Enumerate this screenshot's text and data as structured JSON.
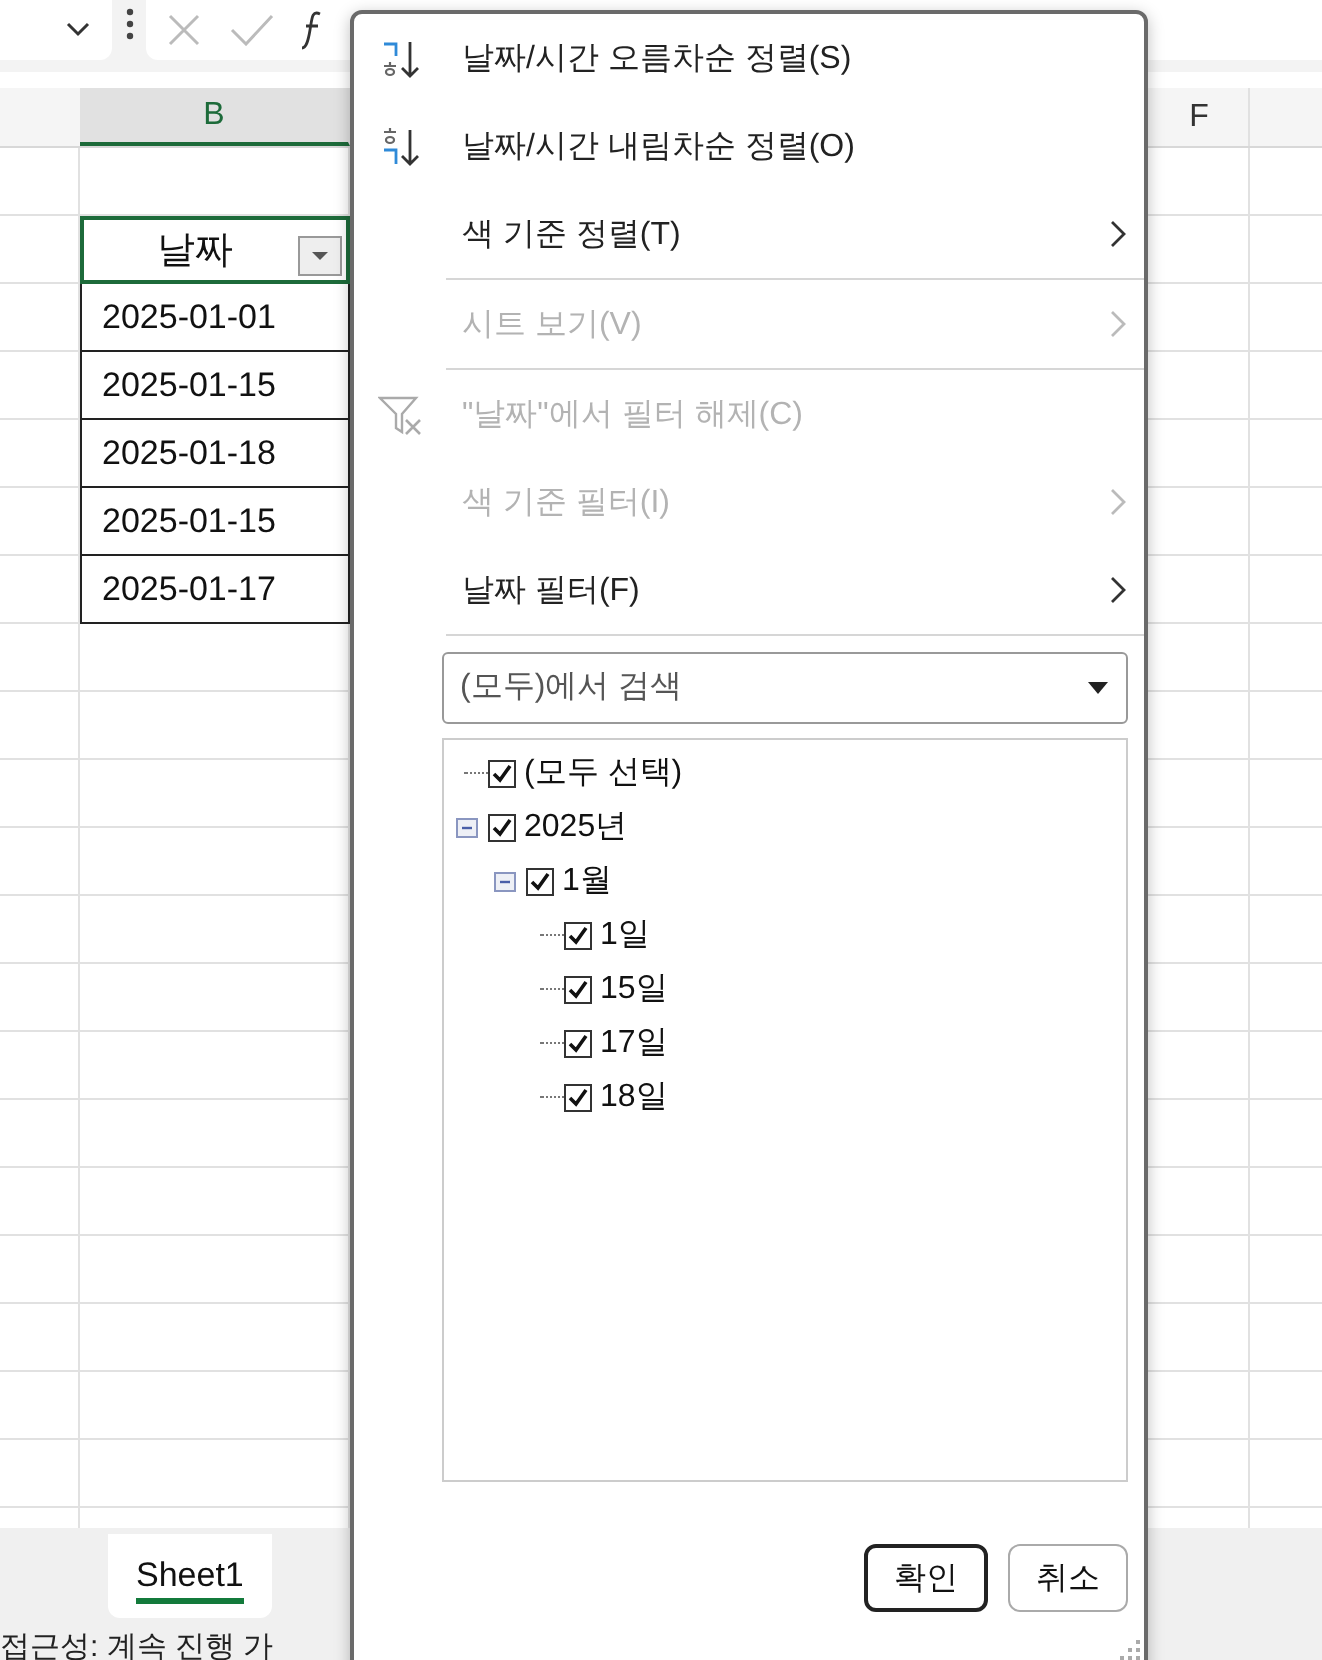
{
  "columns": [
    {
      "label": "B",
      "selected": true
    },
    {
      "label": "F",
      "selected": false
    }
  ],
  "table": {
    "header": "날짜",
    "rows": [
      "2025-01-01",
      "2025-01-15",
      "2025-01-18",
      "2025-01-15",
      "2025-01-17"
    ]
  },
  "sheet_tabs": [
    {
      "label": "Sheet1",
      "selected": true
    }
  ],
  "status_bar": "접근성: 계속 진행 가",
  "filter_menu": {
    "items": [
      {
        "kind": "sort_ascending",
        "label": "날짜/시간 오름차순 정렬(S)",
        "disabled": false,
        "submenu": false
      },
      {
        "kind": "sort_descending",
        "label": "날짜/시간 내림차순 정렬(O)",
        "disabled": false,
        "submenu": false
      },
      {
        "kind": "plain",
        "label": "색 기준 정렬(T)",
        "disabled": false,
        "submenu": true
      },
      {
        "kind": "separator"
      },
      {
        "kind": "plain",
        "label": "시트 보기(V)",
        "disabled": true,
        "submenu": true
      },
      {
        "kind": "separator"
      },
      {
        "kind": "clear_filter",
        "label": "\"날짜\"에서 필터 해제(C)",
        "disabled": true,
        "submenu": false
      },
      {
        "kind": "plain",
        "label": "색 기준 필터(I)",
        "disabled": true,
        "submenu": true
      },
      {
        "kind": "plain",
        "label": "날짜 필터(F)",
        "disabled": false,
        "submenu": true
      },
      {
        "kind": "separator"
      }
    ],
    "search": {
      "placeholder": "(모두)에서 검색"
    },
    "tree": [
      {
        "label": "(모두 선택)",
        "checked": true
      },
      {
        "label": "2025년",
        "checked": true,
        "expanded": true,
        "children": [
          {
            "label": "1월",
            "checked": true,
            "expanded": true,
            "children": [
              {
                "label": "1일",
                "checked": true
              },
              {
                "label": "15일",
                "checked": true
              },
              {
                "label": "17일",
                "checked": true
              },
              {
                "label": "18일",
                "checked": true
              }
            ]
          }
        ]
      }
    ],
    "buttons": [
      {
        "label": "확인",
        "default": true
      },
      {
        "label": "취소",
        "default": false
      }
    ]
  }
}
